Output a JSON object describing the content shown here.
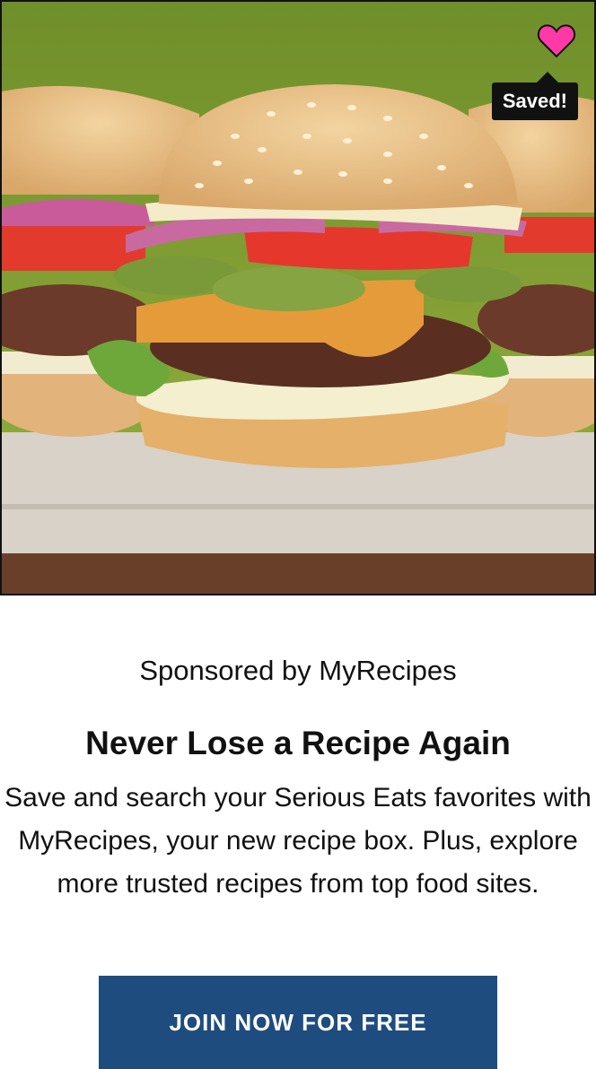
{
  "hero": {
    "saved_label": "Saved!"
  },
  "promo": {
    "sponsor": "Sponsored by MyRecipes",
    "headline": "Never Lose a Recipe Again",
    "description": "Save and search your Serious Eats favorites with MyRecipes, your new recipe box. Plus, explore more trusted recipes from top food sites.",
    "cta_label": "JOIN NOW FOR FREE"
  },
  "icons": {
    "heart": "heart-icon"
  },
  "colors": {
    "cta_background": "#1f4c7e",
    "heart": "#ff3aa7",
    "badge": "#111111"
  }
}
